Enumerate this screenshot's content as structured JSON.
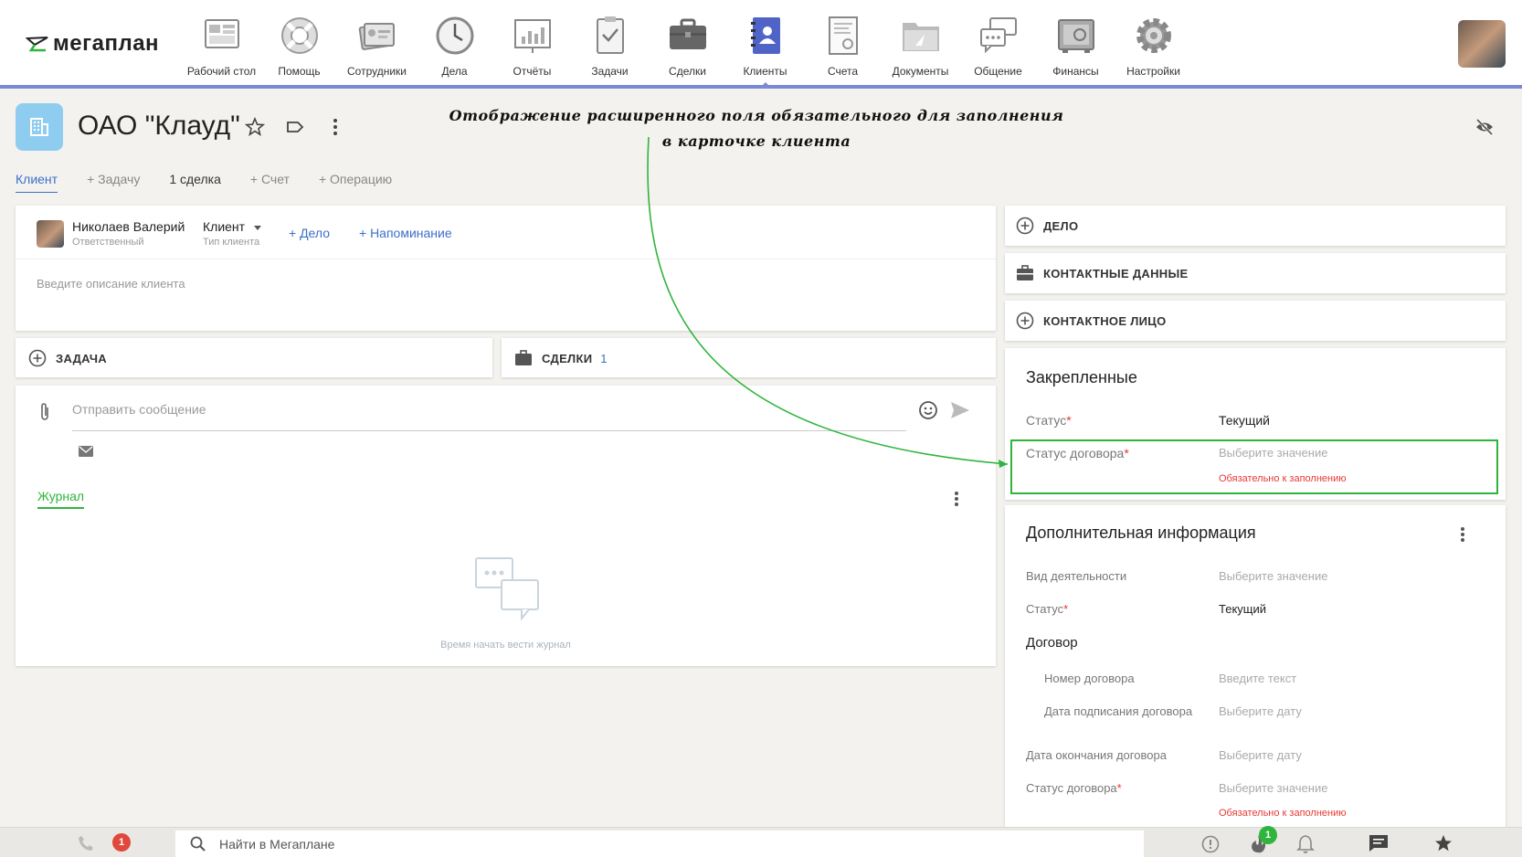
{
  "app": {
    "logo_text": "мегаплан"
  },
  "nav": [
    {
      "label": "Рабочий стол",
      "icon": "dashboard-icon"
    },
    {
      "label": "Помощь",
      "icon": "lifebuoy-icon"
    },
    {
      "label": "Сотрудники",
      "icon": "employees-icon"
    },
    {
      "label": "Дела",
      "icon": "clock-icon"
    },
    {
      "label": "Отчёты",
      "icon": "reports-icon"
    },
    {
      "label": "Задачи",
      "icon": "tasks-icon"
    },
    {
      "label": "Сделки",
      "icon": "briefcase-icon"
    },
    {
      "label": "Клиенты",
      "icon": "clients-icon"
    },
    {
      "label": "Счета",
      "icon": "invoice-icon"
    },
    {
      "label": "Документы",
      "icon": "documents-icon"
    },
    {
      "label": "Общение",
      "icon": "chat-icon"
    },
    {
      "label": "Финансы",
      "icon": "safe-icon"
    },
    {
      "label": "Настройки",
      "icon": "gear-icon"
    }
  ],
  "header": {
    "title": "ОАО \"Клауд\"",
    "annotation": "Отображение расширенного поля обязательного для заполнения в карточке клиента"
  },
  "tabs": [
    "Клиент",
    "+ Задачу",
    "1 сделка",
    "+ Счет",
    "+ Операцию"
  ],
  "client_card": {
    "responsible_name": "Николаев Валерий",
    "responsible_role": "Ответственный",
    "client_type": "Клиент",
    "client_type_label": "Тип клиента",
    "add_deal": "+ Дело",
    "add_reminder": "+ Напоминание",
    "description_placeholder": "Введите описание клиента"
  },
  "task_card": {
    "label": "ЗАДАЧА"
  },
  "deals_card": {
    "label": "СДЕЛКИ",
    "count": "1"
  },
  "message": {
    "placeholder": "Отправить сообщение",
    "journal_tab": "Журнал",
    "empty_text": "Время начать вести журнал"
  },
  "right_sections": [
    {
      "label": "ДЕЛО",
      "icon": "plus-circle-icon"
    },
    {
      "label": "КОНТАКТНЫЕ ДАННЫЕ",
      "icon": "briefcase-icon"
    },
    {
      "label": "КОНТАКТНОЕ ЛИЦО",
      "icon": "plus-circle-icon"
    }
  ],
  "pinned": {
    "title": "Закрепленные",
    "status_label": "Статус",
    "status_value": "Текущий",
    "contract_status_label": "Статус договора",
    "contract_status_placeholder": "Выберите значение",
    "required_error": "Обязательно к заполнению"
  },
  "additional": {
    "title": "Дополнительная информация",
    "activity_label": "Вид деятельности",
    "activity_placeholder": "Выберите значение",
    "status_label": "Статус",
    "status_value": "Текущий",
    "contract_group": "Договор",
    "contract_number_label": "Номер договора",
    "contract_number_placeholder": "Введите текст",
    "sign_date_label": "Дата подписания договора",
    "sign_date_placeholder": "Выберите дату",
    "end_date_label": "Дата окончания договора",
    "end_date_placeholder": "Выберите дату",
    "contract_status_label": "Статус договора",
    "contract_status_placeholder": "Выберите значение",
    "required_error": "Обязательно к заполнению"
  },
  "bottom": {
    "calls_badge": "1",
    "search_placeholder": "Найти в Мегаплане",
    "fire_badge": "1"
  },
  "colors": {
    "accent": "#3b6fc9",
    "nav_underline": "#7b88d6",
    "annotation_green": "#2fb43c",
    "required": "#e53935",
    "badge_red": "#e0483d",
    "badge_green": "#2fb43c"
  }
}
